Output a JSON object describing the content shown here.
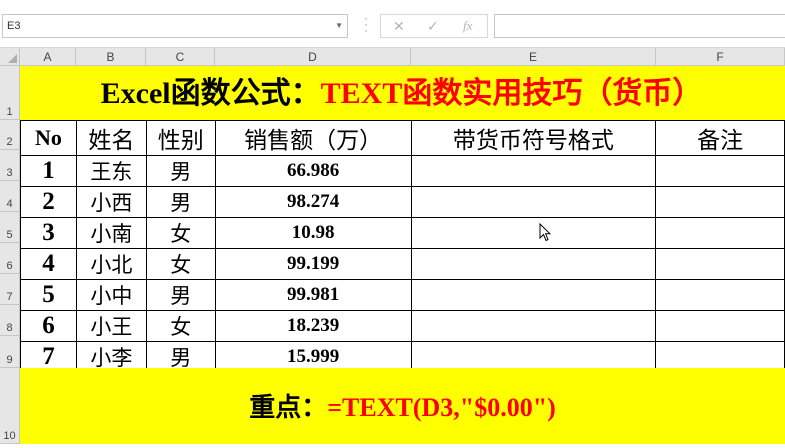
{
  "name_box": {
    "value": "E3",
    "dropdown_icon": "chevron-down-icon"
  },
  "formula_bar": {
    "cancel_icon": "x-icon",
    "enter_icon": "check-icon",
    "insert_function_label": "fx",
    "formula_value": ""
  },
  "columns": [
    "A",
    "B",
    "C",
    "D",
    "E",
    "F"
  ],
  "rows": [
    "1",
    "2",
    "3",
    "4",
    "5",
    "6",
    "7",
    "8",
    "9",
    "10"
  ],
  "title": {
    "part1": "Excel函数公式：",
    "part2": "TEXT函数实用技巧（货币）"
  },
  "headers": [
    "No",
    "姓名",
    "性别",
    "销售额（万）",
    "带货币符号格式",
    "备注"
  ],
  "records": [
    {
      "no": "1",
      "name": "王东",
      "gender": "男",
      "sales": "66.986",
      "formatted": "",
      "note": ""
    },
    {
      "no": "2",
      "name": "小西",
      "gender": "男",
      "sales": "98.274",
      "formatted": "",
      "note": ""
    },
    {
      "no": "3",
      "name": "小南",
      "gender": "女",
      "sales": "10.98",
      "formatted": "",
      "note": ""
    },
    {
      "no": "4",
      "name": "小北",
      "gender": "女",
      "sales": "99.199",
      "formatted": "",
      "note": ""
    },
    {
      "no": "5",
      "name": "小中",
      "gender": "男",
      "sales": "99.981",
      "formatted": "",
      "note": ""
    },
    {
      "no": "6",
      "name": "小王",
      "gender": "女",
      "sales": "18.239",
      "formatted": "",
      "note": ""
    },
    {
      "no": "7",
      "name": "小李",
      "gender": "男",
      "sales": "15.999",
      "formatted": "",
      "note": ""
    }
  ],
  "key_point": {
    "label": "重点：",
    "formula": "=TEXT(D3,\"$0.00\")"
  },
  "colors": {
    "highlight": "#ffff00",
    "accent_red": "#ff0000",
    "header_gray": "#e6e6e6"
  },
  "cursor": "arrow-cursor-icon"
}
